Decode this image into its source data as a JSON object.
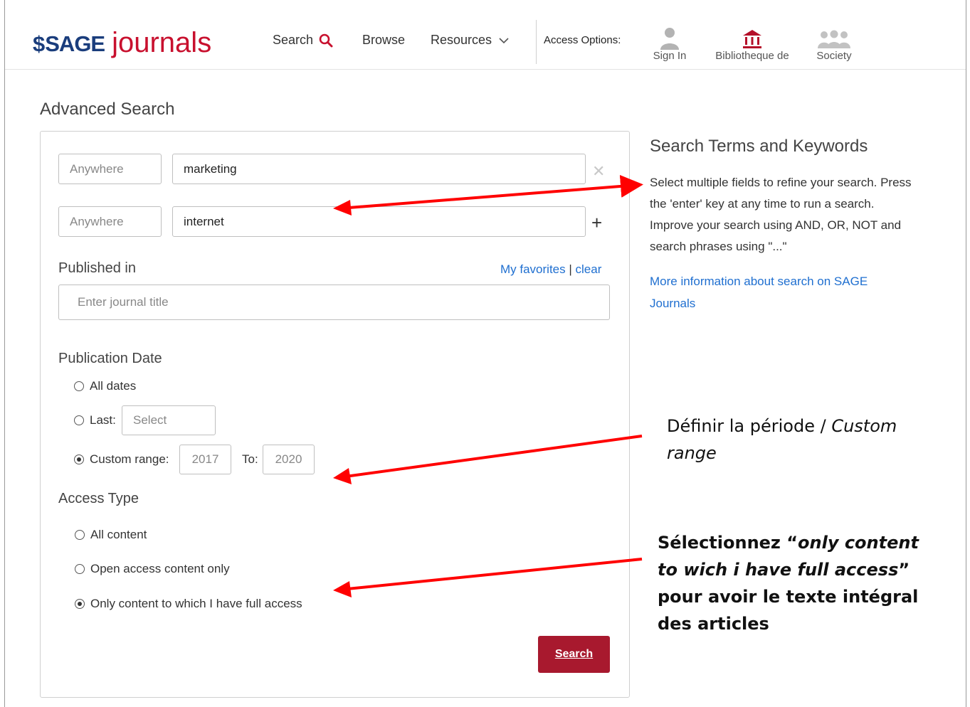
{
  "header": {
    "logo_brand": "SAGE",
    "logo_product": "journals",
    "nav": {
      "search": "Search",
      "browse": "Browse",
      "resources": "Resources"
    },
    "access_options_label": "Access Options:",
    "access_options": [
      {
        "label": "Sign In",
        "icon": "person-icon"
      },
      {
        "label": "Bibliotheque de",
        "icon": "library-icon"
      },
      {
        "label": "Society",
        "icon": "group-icon"
      }
    ]
  },
  "page_title": "Advanced Search",
  "search_rows": [
    {
      "scope_placeholder": "Anywhere",
      "term": "marketing"
    },
    {
      "scope_placeholder": "Anywhere",
      "term": "internet"
    }
  ],
  "published_in": {
    "label": "Published in",
    "favorites_link": "My favorites",
    "separator": "|",
    "clear_link": "clear",
    "journal_placeholder": "Enter journal title"
  },
  "publication_date": {
    "label": "Publication Date",
    "options": {
      "all": "All dates",
      "last": "Last:",
      "custom": "Custom range:"
    },
    "last_select_placeholder": "Select",
    "selected": "custom",
    "from_year": "2017",
    "to_label": "To:",
    "to_year": "2020"
  },
  "access_type": {
    "label": "Access Type",
    "options": {
      "all": "All content",
      "open": "Open access content only",
      "full": "Only content to which I have full access"
    },
    "selected": "full"
  },
  "search_button": "Search",
  "help": {
    "title": "Search Terms and Keywords",
    "text": "Select multiple fields to refine your search. Press the 'enter' key at any time to run a search. Improve your search using AND, OR, NOT and search phrases using \"...\"",
    "link": "More information about search on SAGE Journals"
  },
  "annotations": {
    "period_plain": "Définir la période / ",
    "period_italic": "Custom range",
    "select_prefix": "Sélectionnez “",
    "select_italic": "only content to wich i have full access",
    "select_suffix": "”",
    "select_line2": "pour avoir le texte intégral des articles"
  },
  "colors": {
    "brand_blue": "#1a3d7c",
    "brand_red": "#c8102e",
    "button_red": "#a8192e",
    "link_blue": "#1f6fd0",
    "arrow_red": "#ff0000"
  }
}
